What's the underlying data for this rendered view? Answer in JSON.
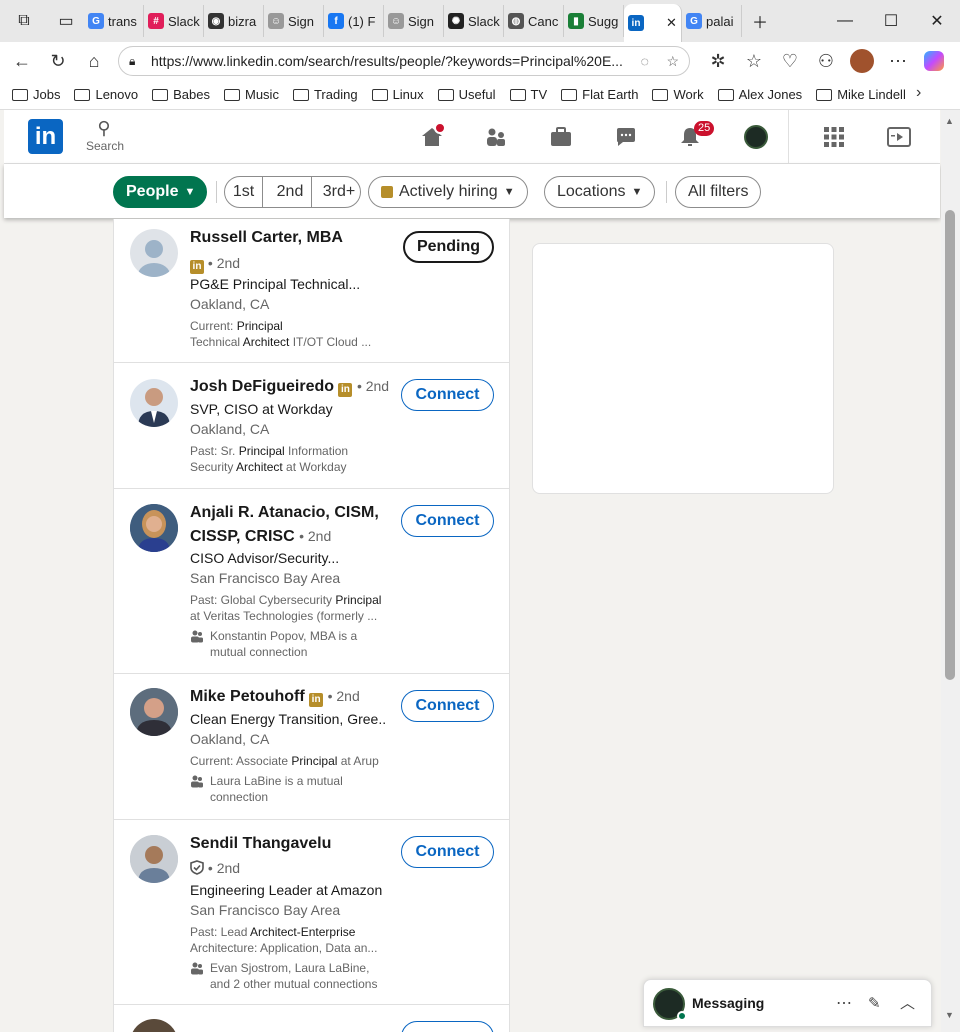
{
  "browser": {
    "tabs": [
      {
        "label": "trans",
        "icon": "google-icon",
        "color": "#4285f4"
      },
      {
        "label": "Slack",
        "icon": "slack-icon",
        "color": "#e01e5a"
      },
      {
        "label": "bizra",
        "icon": "github-icon",
        "color": "#333333"
      },
      {
        "label": "Sign",
        "icon": "person-icon",
        "color": "#999999"
      },
      {
        "label": "(1) F",
        "icon": "facebook-icon",
        "color": "#1877f2"
      },
      {
        "label": "Sign",
        "icon": "person-icon",
        "color": "#999999"
      },
      {
        "label": "Slack",
        "icon": "openai-icon",
        "color": "#222222"
      },
      {
        "label": "Canc",
        "icon": "globe-icon",
        "color": "#555555"
      },
      {
        "label": "Sugg",
        "icon": "green-icon",
        "color": "#1a7f37"
      },
      {
        "label": "",
        "icon": "linkedin-icon",
        "color": "#0a66c2"
      },
      {
        "label": "palai",
        "icon": "google-icon",
        "color": "#4285f4"
      }
    ],
    "url": "https://www.linkedin.com/search/results/people/?keywords=Principal%20E...",
    "bookmarks": [
      "Jobs",
      "Lenovo",
      "Babes",
      "Music",
      "Trading",
      "Linux",
      "Useful",
      "TV",
      "Flat Earth",
      "Work",
      "Alex Jones",
      "Mike Lindell"
    ]
  },
  "header": {
    "search_label": "Search",
    "notification_count": "25"
  },
  "filters": {
    "people": "People",
    "first": "1st",
    "second": "2nd",
    "third": "3rd+",
    "hiring": "Actively hiring",
    "locations": "Locations",
    "all": "All filters"
  },
  "results": [
    {
      "name": "Russell Carter, MBA",
      "degree": "2nd",
      "headline": "PG&E Principal Technical...",
      "location": "Oakland, CA",
      "detail_prefix": "Current: ",
      "detail_1": "Principal",
      "detail_2": "Technical ",
      "detail_3": "Architect",
      "detail_4": " IT/OT Cloud ...",
      "action": "Pending"
    },
    {
      "name": "Josh DeFigueiredo",
      "degree": "2nd",
      "headline": "SVP, CISO at Workday",
      "location": "Oakland, CA",
      "detail_prefix": "Past: Sr. ",
      "detail_1": "Principal",
      "detail_2": " Information Security ",
      "detail_3": "Architect",
      "detail_4": " at Workday",
      "action": "Connect"
    },
    {
      "name": "Anjali R. Atanacio, CISM,",
      "name2": "CISSP, CRISC",
      "degree": "2nd",
      "headline": "CISO Advisor/Security...",
      "location": "San Francisco Bay Area",
      "detail_prefix": "Past: Global Cybersecurity ",
      "detail_1": "Principal",
      "detail_2": " at Veritas Technologies (formerly ...",
      "mutual": "Konstantin Popov, MBA is a mutual connection",
      "action": "Connect"
    },
    {
      "name": "Mike Petouhoff",
      "degree": "2nd",
      "headline": "Clean Energy Transition, Gree...",
      "location": "Oakland, CA",
      "detail_prefix": "Current: Associate ",
      "detail_1": "Principal",
      "detail_2": " at Arup",
      "mutual": "Laura LaBine is a mutual connection",
      "action": "Connect"
    },
    {
      "name": "Sendil Thangavelu",
      "degree": "2nd",
      "headline": "Engineering Leader at Amazon",
      "location": "San Francisco Bay Area",
      "detail_prefix": "Past: Lead ",
      "detail_1": "Architect-Enterprise",
      "detail_2": " Architecture: Application, Data an...",
      "mutual": "Evan Sjostrom, Laura LaBine, and 2 other mutual connections",
      "action": "Connect"
    }
  ],
  "messaging": {
    "label": "Messaging"
  }
}
